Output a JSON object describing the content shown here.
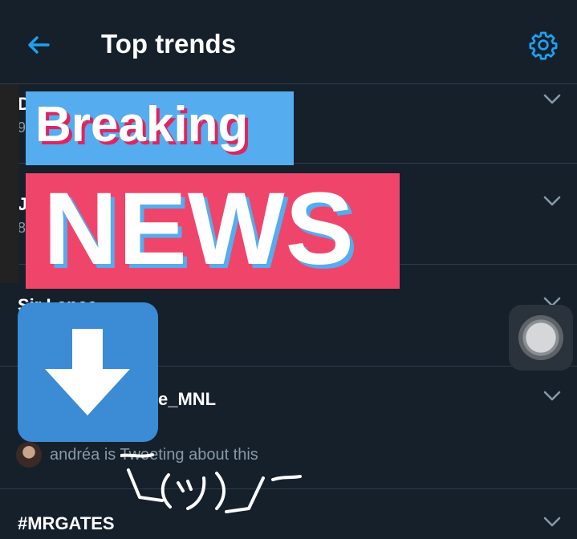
{
  "header": {
    "title": "Top trends",
    "back_icon": "arrow-left-icon",
    "settings_icon": "gear-icon",
    "accent": "#1da1f2"
  },
  "trends": [
    {
      "name": "D",
      "meta": "9"
    },
    {
      "name": "J",
      "meta": "8"
    },
    {
      "name": "Sir Lance",
      "meta": ""
    },
    {
      "name": "e_MNL",
      "meta": ""
    },
    {
      "name": "#MRGATES",
      "meta": ""
    }
  ],
  "social_context": {
    "text": "andréa is Tweeting about this",
    "avatar": "user-avatar"
  },
  "overlay": {
    "breaking_label": "Breaking",
    "news_label": "NEWS",
    "breaking_color": "#55acee",
    "news_color": "#f0456a",
    "download_icon": "down-arrow-icon",
    "shrug_text": "¯\\_(ツ)_/¯"
  }
}
